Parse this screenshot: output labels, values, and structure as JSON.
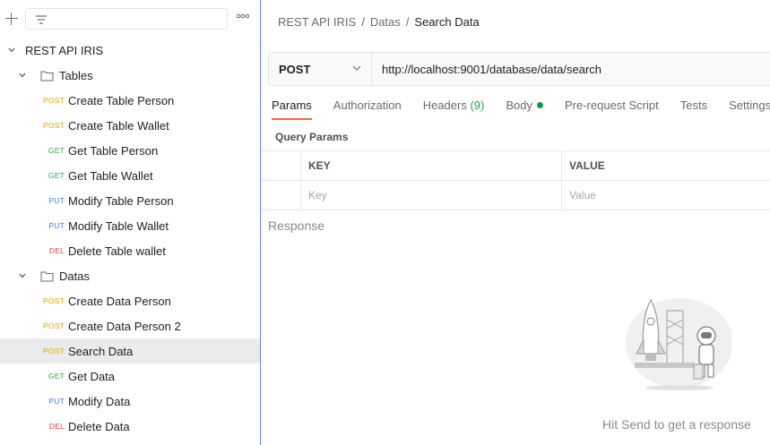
{
  "sidebar": {
    "collection": "REST API IRIS",
    "folders": [
      {
        "name": "Tables",
        "requests": [
          {
            "method": "POST",
            "name": "Create Table Person"
          },
          {
            "method": "POST",
            "name": "Create Table Wallet"
          },
          {
            "method": "GET",
            "name": "Get Table Person"
          },
          {
            "method": "GET",
            "name": "Get Table Wallet"
          },
          {
            "method": "PUT",
            "name": "Modify Table Person"
          },
          {
            "method": "PUT",
            "name": "Modify Table Wallet"
          },
          {
            "method": "DEL",
            "name": "Delete Table wallet"
          }
        ]
      },
      {
        "name": "Datas",
        "requests": [
          {
            "method": "POST",
            "name": "Create Data Person"
          },
          {
            "method": "POST",
            "name": "Create Data Person 2"
          },
          {
            "method": "POST",
            "name": "Search Data",
            "selected": true
          },
          {
            "method": "GET",
            "name": "Get Data"
          },
          {
            "method": "PUT",
            "name": "Modify Data"
          },
          {
            "method": "DEL",
            "name": "Delete Data"
          }
        ]
      }
    ]
  },
  "breadcrumb": {
    "items": [
      "REST API IRIS",
      "Datas"
    ],
    "separator": "/",
    "current": "Search Data"
  },
  "request": {
    "method": "POST",
    "url": "http://localhost:9001/database/data/search"
  },
  "tabs": [
    {
      "label": "Params",
      "active": true
    },
    {
      "label": "Authorization"
    },
    {
      "label": "Headers",
      "count": "(9)"
    },
    {
      "label": "Body",
      "dot": true
    },
    {
      "label": "Pre-request Script"
    },
    {
      "label": "Tests"
    },
    {
      "label": "Settings"
    }
  ],
  "params": {
    "title": "Query Params",
    "key_header": "KEY",
    "value_header": "VALUE",
    "key_placeholder": "Key",
    "value_placeholder": "Value"
  },
  "response": {
    "label": "Response",
    "hint": "Hit Send to get a response"
  },
  "colors": {
    "post": "#e6a400",
    "get": "#2ea44f",
    "put": "#3b7ddd",
    "del": "#e0453a",
    "accent": "#f26b3a"
  }
}
